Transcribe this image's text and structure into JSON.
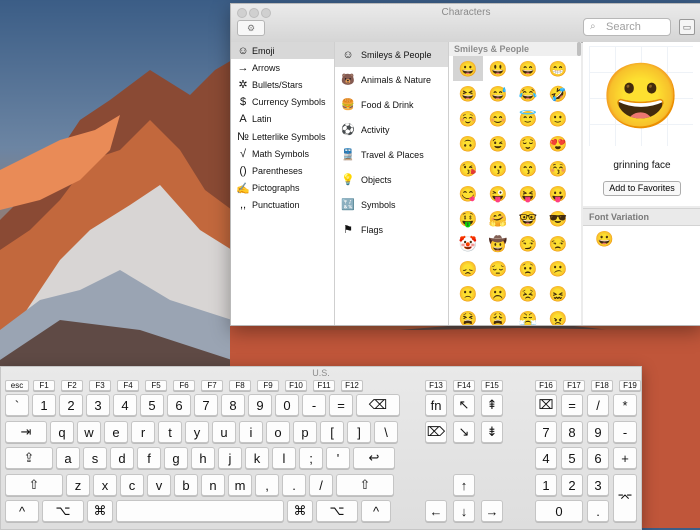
{
  "characters_window": {
    "title": "Characters",
    "search_placeholder": "Search",
    "gear_label": "⚙︎",
    "categories": [
      {
        "icon": "☺",
        "label": "Emoji"
      },
      {
        "icon": "→",
        "label": "Arrows"
      },
      {
        "icon": "✲",
        "label": "Bullets/Stars"
      },
      {
        "icon": "$",
        "label": "Currency Symbols"
      },
      {
        "icon": "A",
        "label": "Latin"
      },
      {
        "icon": "№",
        "label": "Letterlike Symbols"
      },
      {
        "icon": "√",
        "label": "Math Symbols"
      },
      {
        "icon": "()",
        "label": "Parentheses"
      },
      {
        "icon": "✍",
        "label": "Pictographs"
      },
      {
        "icon": ",,",
        "label": "Punctuation"
      }
    ],
    "subcategories": [
      {
        "icon": "☺",
        "label": "Smileys & People"
      },
      {
        "icon": "🐻",
        "label": "Animals & Nature"
      },
      {
        "icon": "🍔",
        "label": "Food & Drink"
      },
      {
        "icon": "⚽",
        "label": "Activity"
      },
      {
        "icon": "🚆",
        "label": "Travel & Places"
      },
      {
        "icon": "💡",
        "label": "Objects"
      },
      {
        "icon": "🔣",
        "label": "Symbols"
      },
      {
        "icon": "⚑",
        "label": "Flags"
      }
    ],
    "grid_header": "Smileys & People",
    "emojis": [
      "😀",
      "😃",
      "😄",
      "😁",
      "😆",
      "😅",
      "😂",
      "🤣",
      "☺️",
      "😊",
      "😇",
      "🙂",
      "🙃",
      "😉",
      "😌",
      "😍",
      "😘",
      "😗",
      "😙",
      "😚",
      "😋",
      "😜",
      "😝",
      "😛",
      "🤑",
      "🤗",
      "🤓",
      "😎",
      "🤡",
      "🤠",
      "😏",
      "😒",
      "😞",
      "😔",
      "😟",
      "😕",
      "🙁",
      "☹️",
      "😣",
      "😖",
      "😫",
      "😩",
      "😤",
      "😠"
    ],
    "selected_char": "😀",
    "selected_name": "grinning face",
    "add_favorites": "Add to Favorites",
    "font_variation_header": "Font Variation",
    "font_variation_char": "😀"
  },
  "keyboard": {
    "title": "U.S.",
    "fn_row": [
      "esc",
      "F1",
      "F2",
      "F3",
      "F4",
      "F5",
      "F6",
      "F7",
      "F8",
      "F9",
      "F10",
      "F11",
      "F12",
      "F13",
      "F14",
      "F15",
      "F16",
      "F17",
      "F18",
      "F19"
    ],
    "row1": [
      "`",
      "1",
      "2",
      "3",
      "4",
      "5",
      "6",
      "7",
      "8",
      "9",
      "0",
      "-",
      "=",
      "⌫"
    ],
    "row2": [
      "⇥",
      "q",
      "w",
      "e",
      "r",
      "t",
      "y",
      "u",
      "i",
      "o",
      "p",
      "[",
      "]",
      "\\"
    ],
    "row3": [
      "⇪",
      "a",
      "s",
      "d",
      "f",
      "g",
      "h",
      "j",
      "k",
      "l",
      ";",
      "'",
      "↩"
    ],
    "row4": [
      "⇧",
      "z",
      "x",
      "c",
      "v",
      "b",
      "n",
      "m",
      ",",
      ".",
      "/",
      "⇧"
    ],
    "row5": [
      "^",
      "⌥",
      "⌘",
      "",
      "⌘",
      "⌥",
      "^"
    ],
    "nav": [
      "fn",
      "↖",
      "⇞",
      "⌦",
      "↘",
      "⇟",
      "↑",
      "←",
      "↓",
      "→"
    ],
    "numpad": [
      "⌧",
      "=",
      "/",
      "*",
      "7",
      "8",
      "9",
      "-",
      "4",
      "5",
      "6",
      "+",
      "1",
      "2",
      "3",
      "⌤",
      "0",
      "."
    ]
  },
  "colors": {
    "accent": "#d8d8d8",
    "window_bg": "#ececec"
  }
}
